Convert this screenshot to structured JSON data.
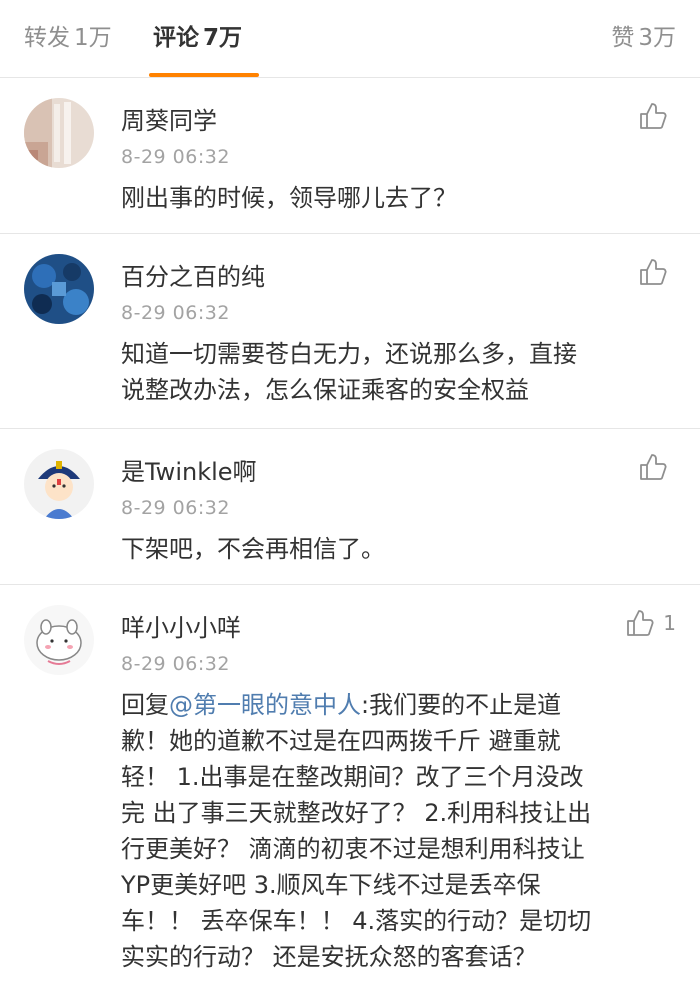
{
  "tabs": {
    "reposts": {
      "label": "转发",
      "count": "1万"
    },
    "comments": {
      "label": "评论",
      "count": "7万"
    },
    "likes": {
      "label": "赞",
      "count": "3万"
    }
  },
  "comments": [
    {
      "user": "周葵同学",
      "time": "8-29 06:32",
      "lines": [
        "刚出事的时候，领导哪儿去了？"
      ],
      "likes": ""
    },
    {
      "user": "百分之百的纯",
      "time": "8-29 06:32",
      "lines": [
        "知道一切需要苍白无力，还说那么多，直接",
        "说整改办法，怎么保证乘客的安全权益"
      ],
      "likes": ""
    },
    {
      "user": "是Twinkle啊",
      "time": "8-29 06:32",
      "lines": [
        "下架吧，不会再相信了。"
      ],
      "likes": ""
    },
    {
      "user": "咩小小小咩",
      "time": "8-29 06:32",
      "reply_prefix": "回复",
      "mention": "@第一眼的意中人",
      "first_line_rest": ":我们要的不止是道",
      "lines": [
        "歉！她的道歉不过是在四两拨千斤 避重就",
        "轻！ 1.出事是在整改期间？改了三个月没改",
        "完 出了事三天就整改好了？ 2.利用科技让出",
        "行更美好？ 滴滴的初衷不过是想利用科技让",
        "YP更美好吧 3.顺风车下线不过是丢卒保",
        "车！！ 丢卒保车！！ 4.落实的行动？是切切",
        "实实的行动？ 还是安抚众怒的客套话？"
      ],
      "likes": "1"
    }
  ]
}
